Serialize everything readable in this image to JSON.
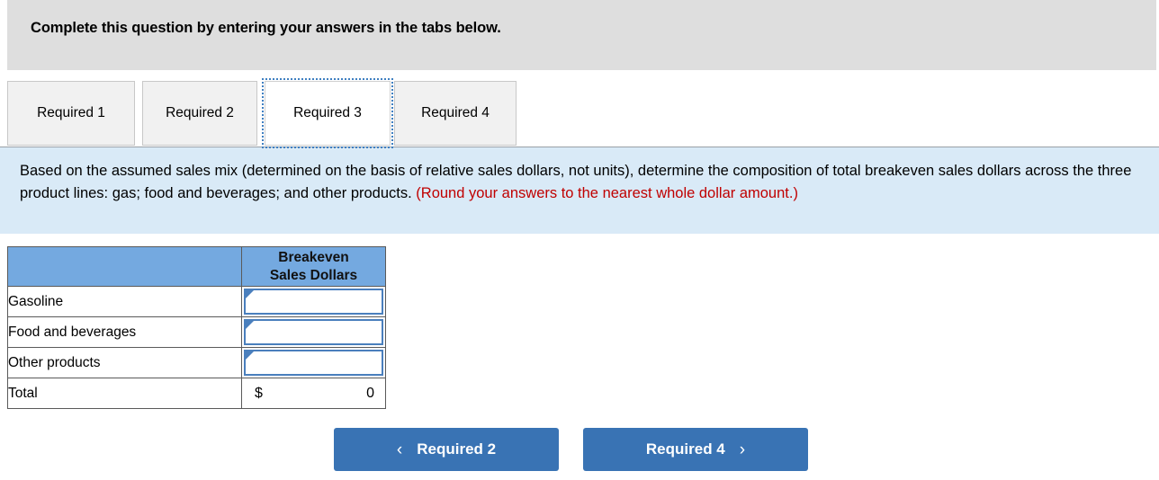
{
  "banner": {
    "text": "Complete this question by entering your answers in the tabs below."
  },
  "tabs": {
    "items": [
      {
        "label": "Required 1",
        "active": false
      },
      {
        "label": "Required 2",
        "active": false
      },
      {
        "label": "Required 3",
        "active": true
      },
      {
        "label": "Required 4",
        "active": false
      }
    ]
  },
  "instructions": {
    "main": "Based on the assumed sales mix (determined on the basis of relative sales dollars, not units), determine the composition of total breakeven sales dollars across the three product lines: gas; food and beverages; and other products. ",
    "round_note": "(Round your answers to the nearest whole dollar amount.)"
  },
  "table": {
    "header_blank": "",
    "header_value_line1": "Breakeven",
    "header_value_line2": "Sales Dollars",
    "rows": [
      {
        "label": "Gasoline",
        "value": "",
        "type": "input"
      },
      {
        "label": "Food and beverages",
        "value": "",
        "type": "input"
      },
      {
        "label": "Other products",
        "value": "",
        "type": "input"
      }
    ],
    "total": {
      "label": "Total",
      "currency": "$",
      "value": "0"
    }
  },
  "nav": {
    "prev_label": "Required 2",
    "next_label": "Required 4",
    "prev_icon": "chevron-left-icon",
    "next_icon": "chevron-right-icon",
    "prev_glyph": "‹",
    "next_glyph": "›"
  },
  "colors": {
    "banner_bg": "#dedede",
    "instruction_bg": "#d9eaf7",
    "table_header_bg": "#74a9e0",
    "input_border": "#4a7fbd",
    "button_bg": "#3973b4",
    "note_red": "#c00000"
  }
}
